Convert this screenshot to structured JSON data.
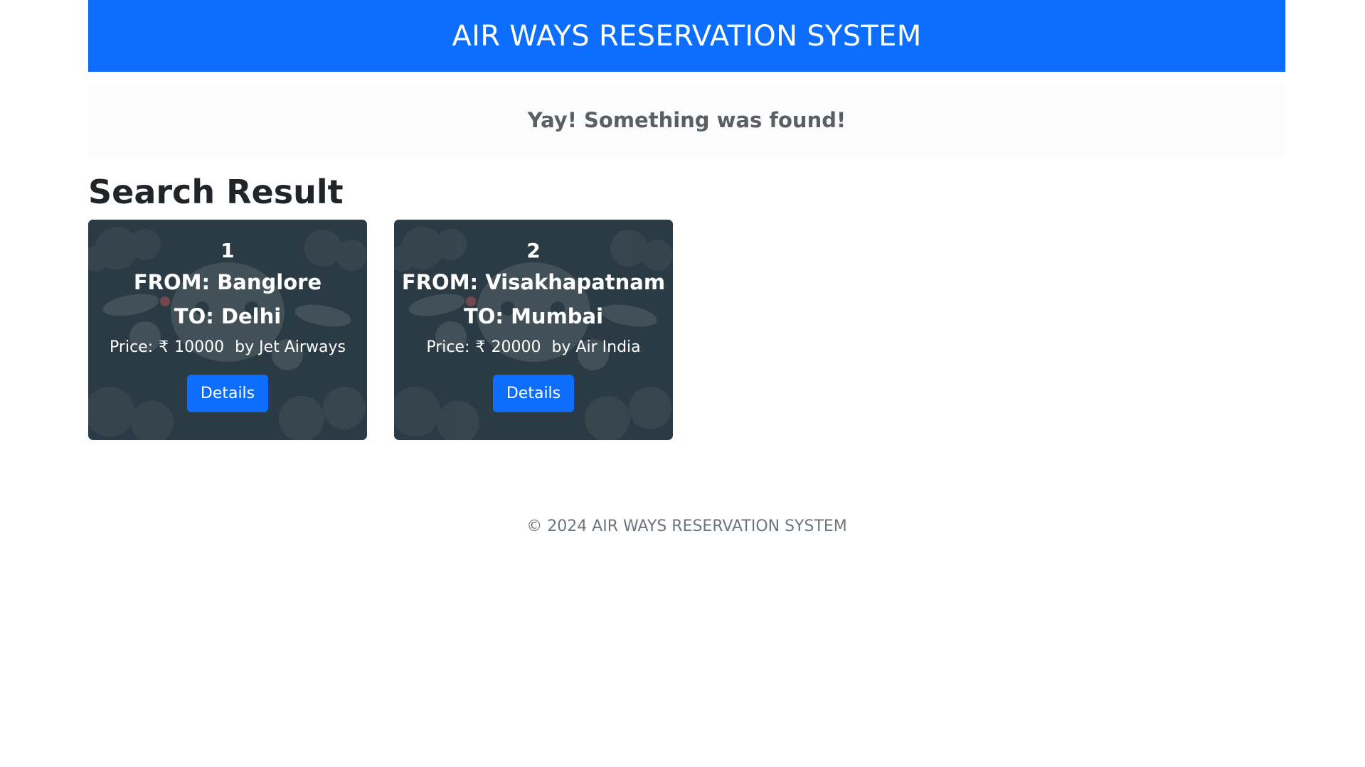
{
  "header": {
    "title": "AIR WAYS RESERVATION SYSTEM"
  },
  "notice": {
    "text": "Yay! Something was found!"
  },
  "results": {
    "title": "Search Result",
    "cards": [
      {
        "number": "1",
        "from": "FROM: Banglore",
        "to": "TO: Delhi",
        "price_label": "Price:",
        "currency": "₹",
        "price": "10000",
        "airline": "by Jet Airways",
        "button": "Details"
      },
      {
        "number": "2",
        "from": "FROM: Visakhapatnam",
        "to": "TO: Mumbai",
        "price_label": "Price:",
        "currency": "₹",
        "price": "20000",
        "airline": "by Air India",
        "button": "Details"
      }
    ]
  },
  "footer": {
    "text": "© 2024 AIR WAYS RESERVATION SYSTEM"
  },
  "colors": {
    "primary": "#0d6efd",
    "card_bg": "#2b3b45"
  }
}
